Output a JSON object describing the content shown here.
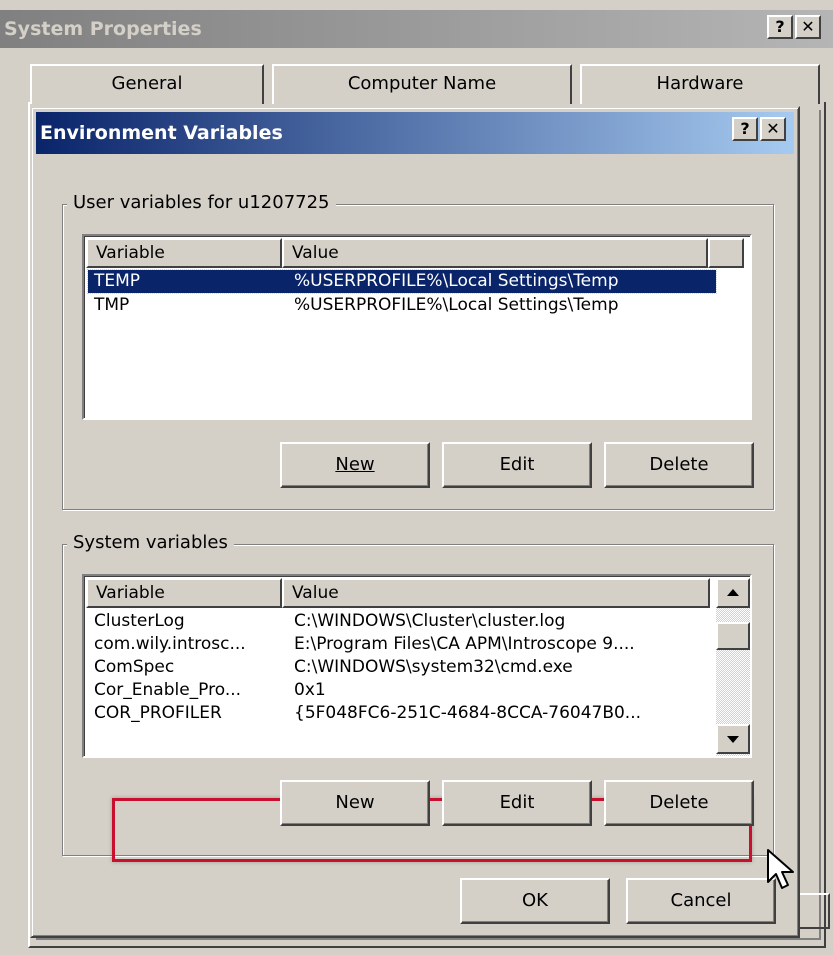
{
  "system_properties": {
    "title": "System Properties",
    "help_label": "?",
    "close_label": "✕",
    "tabs": [
      "General",
      "Computer Name",
      "Hardware"
    ]
  },
  "env_dialog": {
    "title": "Environment Variables",
    "help_label": "?",
    "close_label": "✕",
    "user_group": {
      "legend": "User variables for u1207725",
      "columns": [
        "Variable",
        "Value"
      ],
      "rows": [
        {
          "variable": "TEMP",
          "value": "%USERPROFILE%\\Local Settings\\Temp",
          "selected": true
        },
        {
          "variable": "TMP",
          "value": "%USERPROFILE%\\Local Settings\\Temp",
          "selected": false
        }
      ],
      "buttons": {
        "new": "New",
        "edit": "Edit",
        "delete": "Delete"
      }
    },
    "system_group": {
      "legend": "System variables",
      "columns": [
        "Variable",
        "Value"
      ],
      "rows": [
        {
          "variable": "ClusterLog",
          "value": "C:\\WINDOWS\\Cluster\\cluster.log"
        },
        {
          "variable": "com.wily.introsc...",
          "value": "E:\\Program Files\\CA APM\\Introscope 9...."
        },
        {
          "variable": "ComSpec",
          "value": "C:\\WINDOWS\\system32\\cmd.exe"
        },
        {
          "variable": "Cor_Enable_Pro...",
          "value": "0x1"
        },
        {
          "variable": "COR_PROFILER",
          "value": "{5F048FC6-251C-4684-8CCA-76047B0..."
        }
      ],
      "buttons": {
        "new": "New",
        "edit": "Edit",
        "delete": "Delete"
      }
    },
    "ok_label": "OK",
    "cancel_label": "Cancel"
  },
  "colors": {
    "active_title_start": "#0a246a",
    "active_title_end": "#a6caf0",
    "inactive_title": "#808080",
    "highlight_border": "#c8102e",
    "face": "#d4d0c8"
  },
  "icons": {
    "scroll_up": "up-arrow-icon",
    "scroll_down": "down-arrow-icon",
    "cursor": "mouse-pointer-icon"
  }
}
